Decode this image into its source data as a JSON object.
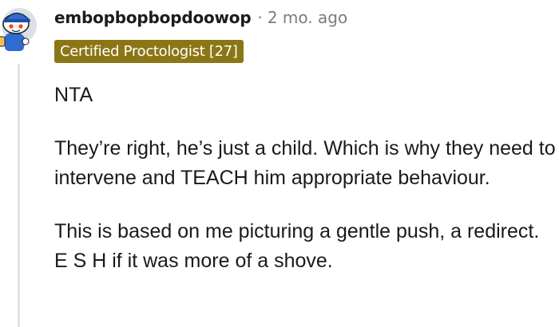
{
  "comment": {
    "username": "embopbopbopdoowop",
    "separator": "·",
    "timestamp": "2 mo. ago",
    "flair": "Certified Proctologist [27]",
    "paragraphs": [
      "NTA",
      "They’re right, he’s just a child. Which is why they need to intervene and TEACH him appropriate behaviour.",
      "This is based on me picturing a gentle push, a redirect. E S H if it was more of a shove."
    ],
    "avatar_icon": "snoo-avatar-icon"
  },
  "colors": {
    "flair_background": "#8b7615",
    "flair_text": "#ffffff",
    "thread_line": "#e3e3e3",
    "muted_text": "#7c7c7c",
    "body_text": "#1a1a1b"
  }
}
